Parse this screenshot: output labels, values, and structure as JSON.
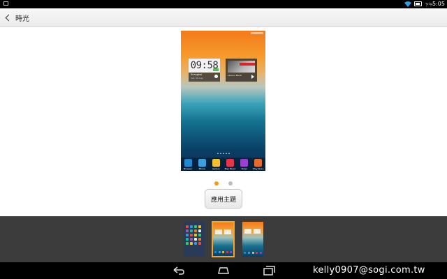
{
  "status_bar": {
    "ampm": "下午",
    "time": "5:05"
  },
  "action_bar": {
    "title": "時光"
  },
  "preview": {
    "clock": {
      "time": "09:58",
      "city": "Shanghai",
      "date": "Sat, 30 Aug"
    },
    "music": {
      "title": "Lenovo Music"
    },
    "dock_items": [
      {
        "label": "Browser",
        "color": "#1e88d2"
      },
      {
        "label": "Phone",
        "color": "#3aa0e0"
      },
      {
        "label": "Gallery",
        "color": "#f2c12e"
      },
      {
        "label": "Play Music",
        "color": "#e8344a"
      },
      {
        "label": "Video",
        "color": "#9b3fd0"
      },
      {
        "label": "Play Store",
        "color": "#e86a2a"
      }
    ]
  },
  "pager": {
    "active_color": "#f39c12",
    "inactive_color": "#bdbdbd",
    "pages": 2,
    "active": 1
  },
  "apply_button": {
    "label": "應用主題"
  },
  "theme_thumbnails": {
    "selected_index": 2,
    "count": 3,
    "selected_border_color": "#f6a623"
  },
  "watermark": {
    "text": "kelly0907@sogi.com.tw"
  }
}
